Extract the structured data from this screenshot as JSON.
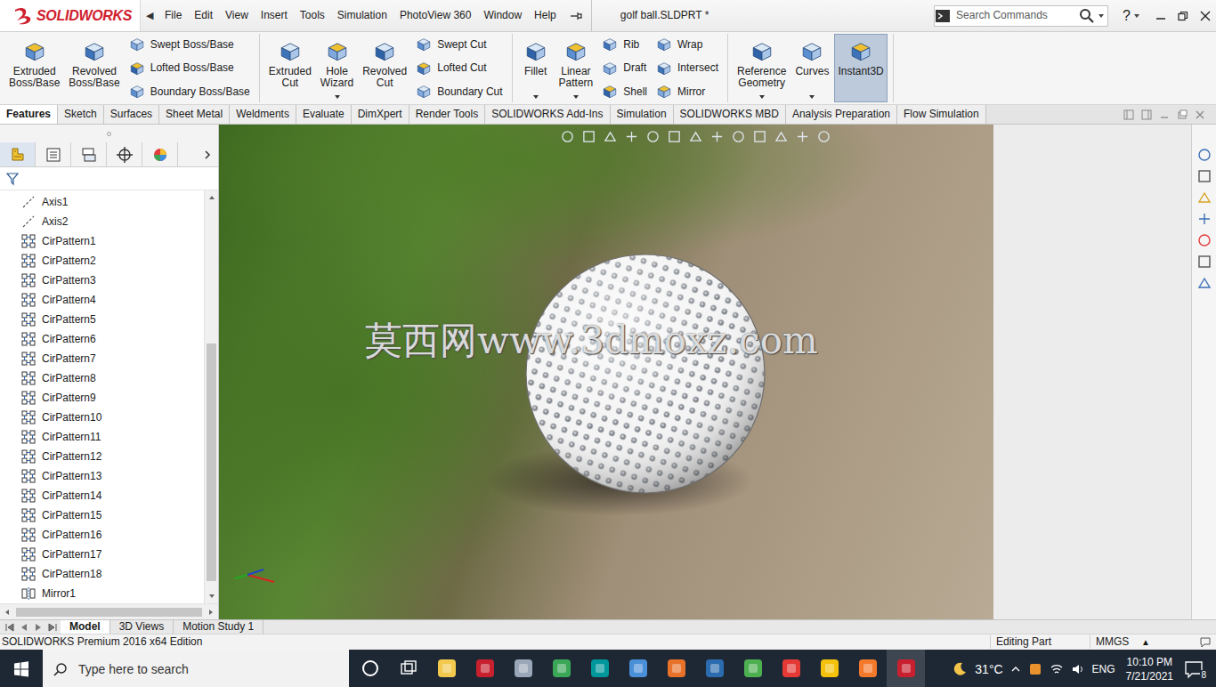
{
  "app": {
    "logo": "SOLIDWORKS",
    "menu_arrow": "◀",
    "menus": [
      "File",
      "Edit",
      "View",
      "Insert",
      "Tools",
      "Simulation",
      "PhotoView 360",
      "Window",
      "Help"
    ],
    "title": "golf ball.SLDPRT *",
    "search": {
      "placeholder": "Search Commands"
    },
    "help": "?"
  },
  "ribbon": {
    "groups": [
      {
        "tools": [
          {
            "kind": "large",
            "label": "Extruded Boss/Base",
            "dropdown": false,
            "on": false
          },
          {
            "kind": "large",
            "label": "Revolved Boss/Base",
            "dropdown": false,
            "on": false
          },
          {
            "kind": "stack",
            "items": [
              "Swept Boss/Base",
              "Lofted Boss/Base",
              "Boundary Boss/Base"
            ]
          }
        ]
      },
      {
        "tools": [
          {
            "kind": "large",
            "label": "Extruded Cut",
            "dropdown": false,
            "on": false
          },
          {
            "kind": "large",
            "label": "Hole Wizard",
            "dropdown": true,
            "on": false
          },
          {
            "kind": "large",
            "label": "Revolved Cut",
            "dropdown": false,
            "on": false
          },
          {
            "kind": "stack",
            "items": [
              "Swept Cut",
              "Lofted Cut",
              "Boundary Cut"
            ]
          }
        ]
      },
      {
        "tools": [
          {
            "kind": "large",
            "label": "Fillet",
            "dropdown": true,
            "on": false
          },
          {
            "kind": "large",
            "label": "Linear Pattern",
            "dropdown": true,
            "on": false
          },
          {
            "kind": "stack",
            "items": [
              "Rib",
              "Draft",
              "Shell"
            ]
          },
          {
            "kind": "stack",
            "items": [
              "Wrap",
              "Intersect",
              "Mirror"
            ]
          }
        ]
      },
      {
        "tools": [
          {
            "kind": "large",
            "label": "Reference Geometry",
            "dropdown": true,
            "on": false
          },
          {
            "kind": "large",
            "label": "Curves",
            "dropdown": true,
            "on": false
          },
          {
            "kind": "large",
            "label": "Instant3D",
            "dropdown": false,
            "on": true
          }
        ]
      }
    ]
  },
  "feature_tabs": [
    {
      "label": "Features",
      "selected": true
    },
    {
      "label": "Sketch",
      "selected": false
    },
    {
      "label": "Surfaces",
      "selected": false
    },
    {
      "label": "Sheet Metal",
      "selected": false
    },
    {
      "label": "Weldments",
      "selected": false
    },
    {
      "label": "Evaluate",
      "selected": false
    },
    {
      "label": "DimXpert",
      "selected": false
    },
    {
      "label": "Render Tools",
      "selected": false
    },
    {
      "label": "SOLIDWORKS Add-Ins",
      "selected": false
    },
    {
      "label": "Simulation",
      "selected": false
    },
    {
      "label": "SOLIDWORKS MBD",
      "selected": false
    },
    {
      "label": "Analysis Preparation",
      "selected": false
    },
    {
      "label": "Flow Simulation",
      "selected": false
    }
  ],
  "sidebar": {
    "tabs": [
      {
        "selected": true
      },
      {
        "selected": false
      },
      {
        "selected": false
      },
      {
        "selected": false
      },
      {
        "selected": false
      }
    ],
    "items": [
      {
        "label": "Axis1",
        "kind": "axis"
      },
      {
        "label": "Axis2",
        "kind": "axis"
      },
      {
        "label": "CirPattern1",
        "kind": "pattern"
      },
      {
        "label": "CirPattern2",
        "kind": "pattern"
      },
      {
        "label": "CirPattern3",
        "kind": "pattern"
      },
      {
        "label": "CirPattern4",
        "kind": "pattern"
      },
      {
        "label": "CirPattern5",
        "kind": "pattern"
      },
      {
        "label": "CirPattern6",
        "kind": "pattern"
      },
      {
        "label": "CirPattern7",
        "kind": "pattern"
      },
      {
        "label": "CirPattern8",
        "kind": "pattern"
      },
      {
        "label": "CirPattern9",
        "kind": "pattern"
      },
      {
        "label": "CirPattern10",
        "kind": "pattern"
      },
      {
        "label": "CirPattern11",
        "kind": "pattern"
      },
      {
        "label": "CirPattern12",
        "kind": "pattern"
      },
      {
        "label": "CirPattern13",
        "kind": "pattern"
      },
      {
        "label": "CirPattern14",
        "kind": "pattern"
      },
      {
        "label": "CirPattern15",
        "kind": "pattern"
      },
      {
        "label": "CirPattern16",
        "kind": "pattern"
      },
      {
        "label": "CirPattern17",
        "kind": "pattern"
      },
      {
        "label": "CirPattern18",
        "kind": "pattern"
      },
      {
        "label": "Mirror1",
        "kind": "mirror"
      }
    ],
    "scroll": {
      "position": 0.36,
      "extent": 0.62
    }
  },
  "viewport": {
    "watermark": "莫西网www.3dmoxz.com"
  },
  "bottom_tabs": [
    {
      "label": "Model",
      "selected": true
    },
    {
      "label": "3D Views",
      "selected": false
    },
    {
      "label": "Motion Study 1",
      "selected": false
    }
  ],
  "status_bar": {
    "edition": "SOLIDWORKS Premium 2016 x64 Edition",
    "mode": "Editing Part",
    "units": "MMGS",
    "units_arrow": "▲"
  },
  "taskbar": {
    "search": {
      "placeholder": "Type here to search"
    },
    "apps": [
      {
        "kind": "ring",
        "color": "#ffffff",
        "active": false
      },
      {
        "kind": "frame",
        "color": "#ffffff",
        "active": false
      },
      {
        "kind": "tile",
        "color": "#f2c94c",
        "active": false
      },
      {
        "kind": "tile",
        "color": "#c8202f",
        "active": false
      },
      {
        "kind": "tile",
        "color": "#9aa7b8",
        "active": false
      },
      {
        "kind": "tile",
        "color": "#3aa757",
        "active": false
      },
      {
        "kind": "tile",
        "color": "#00979c",
        "active": false
      },
      {
        "kind": "tile",
        "color": "#4a90d9",
        "active": false
      },
      {
        "kind": "tile",
        "color": "#e8722a",
        "active": false
      },
      {
        "kind": "tile",
        "color": "#2b6cb0",
        "active": false
      },
      {
        "kind": "tile",
        "color": "#4caf50",
        "active": false
      },
      {
        "kind": "tile",
        "color": "#e53935",
        "active": false
      },
      {
        "kind": "tile",
        "color": "#f4c20d",
        "active": false
      },
      {
        "kind": "tile",
        "color": "#f5792a",
        "active": false
      },
      {
        "kind": "tile",
        "color": "#c8202f",
        "active": true
      }
    ],
    "weather": "31°C",
    "language": "ENG",
    "time": "10:10 PM",
    "date": "7/21/2021",
    "notifications": "8"
  }
}
